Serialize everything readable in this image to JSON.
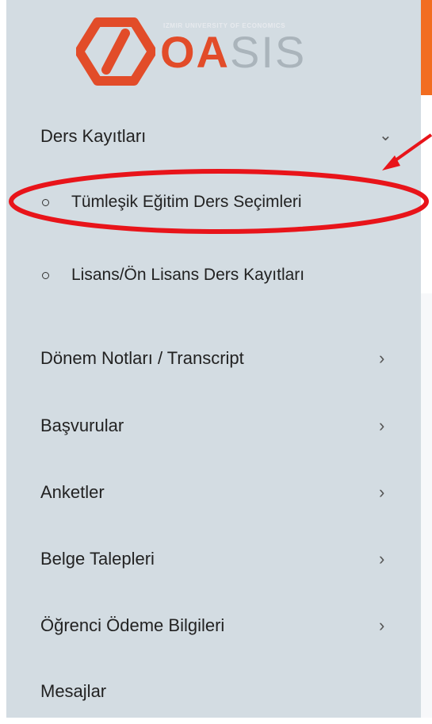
{
  "logo": {
    "subtitle": "IZMIR UNIVERSITY OF ECONOMICS",
    "word_accent": "OA",
    "word_rest": "SIS",
    "icon": "hexagon-slash-icon"
  },
  "menu": {
    "ders_kayitlari": {
      "label": "Ders Kayıtları",
      "chevron": "⌄",
      "icon": "chevron-down-icon"
    },
    "submenu": [
      {
        "label": "Tümleşik Eğitim Ders Seçimleri",
        "highlighted": true
      },
      {
        "label": "Lisans/Ön Lisans Ders Kayıtları",
        "highlighted": false
      }
    ],
    "items": [
      {
        "label": "Dönem Notları / Transcript",
        "chevron": "›"
      },
      {
        "label": "Başvurular",
        "chevron": "›"
      },
      {
        "label": "Anketler",
        "chevron": "›"
      },
      {
        "label": "Belge Talepleri",
        "chevron": "›"
      },
      {
        "label": "Öğrenci Ödeme Bilgileri",
        "chevron": "›"
      },
      {
        "label": "Mesajlar",
        "chevron": ""
      }
    ]
  },
  "colors": {
    "sidebar_bg": "#d3dce2",
    "accent_orange": "#f26d21",
    "logo_red": "#e24c29",
    "annotation_red": "#e8141a"
  }
}
